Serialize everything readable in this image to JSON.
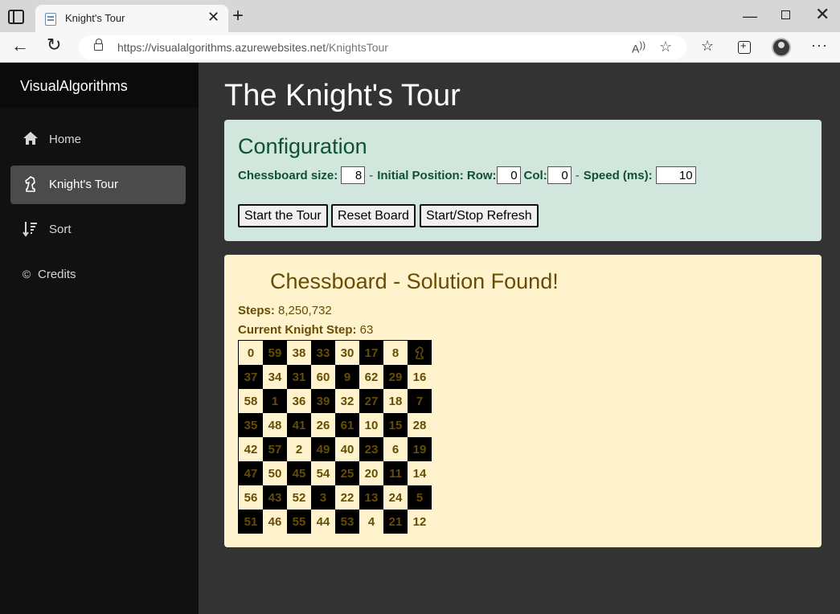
{
  "browser": {
    "tab_title": "Knight's Tour",
    "url_host": "https://visualalgorithms.azurewebsites.net",
    "url_path": "/KnightsTour"
  },
  "sidebar": {
    "brand": "VisualAlgorithms",
    "items": [
      {
        "label": "Home",
        "icon": "home-icon",
        "active": false
      },
      {
        "label": "Knight's Tour",
        "icon": "knight-icon",
        "active": true
      },
      {
        "label": "Sort",
        "icon": "sort-icon",
        "active": false
      },
      {
        "label": "Credits",
        "icon": "copyright-icon",
        "active": false
      }
    ]
  },
  "main": {
    "title": "The Knight's Tour",
    "config": {
      "title": "Configuration",
      "size_label": "Chessboard size:",
      "size_value": "8",
      "dash1": "-",
      "position_label": "Initial Position: Row:",
      "row_value": "0",
      "col_label": "Col:",
      "col_value": "0",
      "dash2": "-",
      "speed_label": "Speed (ms):",
      "speed_value": "10",
      "start_button": "Start the Tour",
      "reset_button": "Reset Board",
      "refresh_button": "Start/Stop Refresh"
    },
    "board": {
      "title": "Chessboard - Solution Found!",
      "steps_label": "Steps:",
      "steps_value": "8,250,732",
      "current_label": "Current Knight Step:",
      "current_value": "63",
      "cells": [
        [
          "0",
          "59",
          "38",
          "33",
          "30",
          "17",
          "8",
          "63"
        ],
        [
          "37",
          "34",
          "31",
          "60",
          "9",
          "62",
          "29",
          "16"
        ],
        [
          "58",
          "1",
          "36",
          "39",
          "32",
          "27",
          "18",
          "7"
        ],
        [
          "35",
          "48",
          "41",
          "26",
          "61",
          "10",
          "15",
          "28"
        ],
        [
          "42",
          "57",
          "2",
          "49",
          "40",
          "23",
          "6",
          "19"
        ],
        [
          "47",
          "50",
          "45",
          "54",
          "25",
          "20",
          "11",
          "14"
        ],
        [
          "56",
          "43",
          "52",
          "3",
          "22",
          "13",
          "24",
          "5"
        ],
        [
          "51",
          "46",
          "55",
          "44",
          "53",
          "4",
          "21",
          "12"
        ]
      ],
      "knight_step": "63"
    }
  }
}
